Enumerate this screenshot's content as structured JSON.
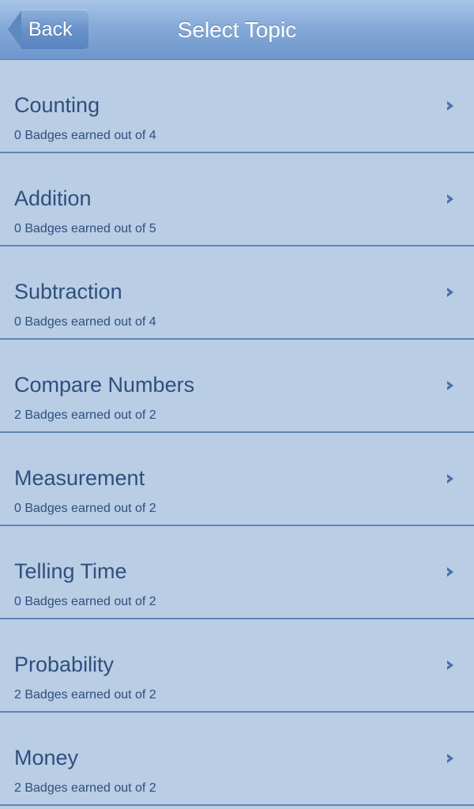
{
  "navbar": {
    "back_label": "Back",
    "title": "Select Topic"
  },
  "topics": [
    {
      "title": "Counting",
      "subtitle": "0 Badges earned out of 4"
    },
    {
      "title": "Addition",
      "subtitle": "0 Badges earned out of 5"
    },
    {
      "title": "Subtraction",
      "subtitle": "0 Badges earned out of 4"
    },
    {
      "title": "Compare Numbers",
      "subtitle": "2 Badges earned out of 2"
    },
    {
      "title": "Measurement",
      "subtitle": "0 Badges earned out of 2"
    },
    {
      "title": "Telling Time",
      "subtitle": "0 Badges earned out of 2"
    },
    {
      "title": "Probability",
      "subtitle": "2 Badges earned out of 2"
    },
    {
      "title": "Money",
      "subtitle": "2 Badges earned out of 2"
    }
  ],
  "colors": {
    "background": "#b9cde4",
    "text": "#2f4f7f",
    "separator": "#5f84b7",
    "navbar": "#86aad8"
  },
  "icons": {
    "row_disclosure": "chevron-right-icon"
  }
}
